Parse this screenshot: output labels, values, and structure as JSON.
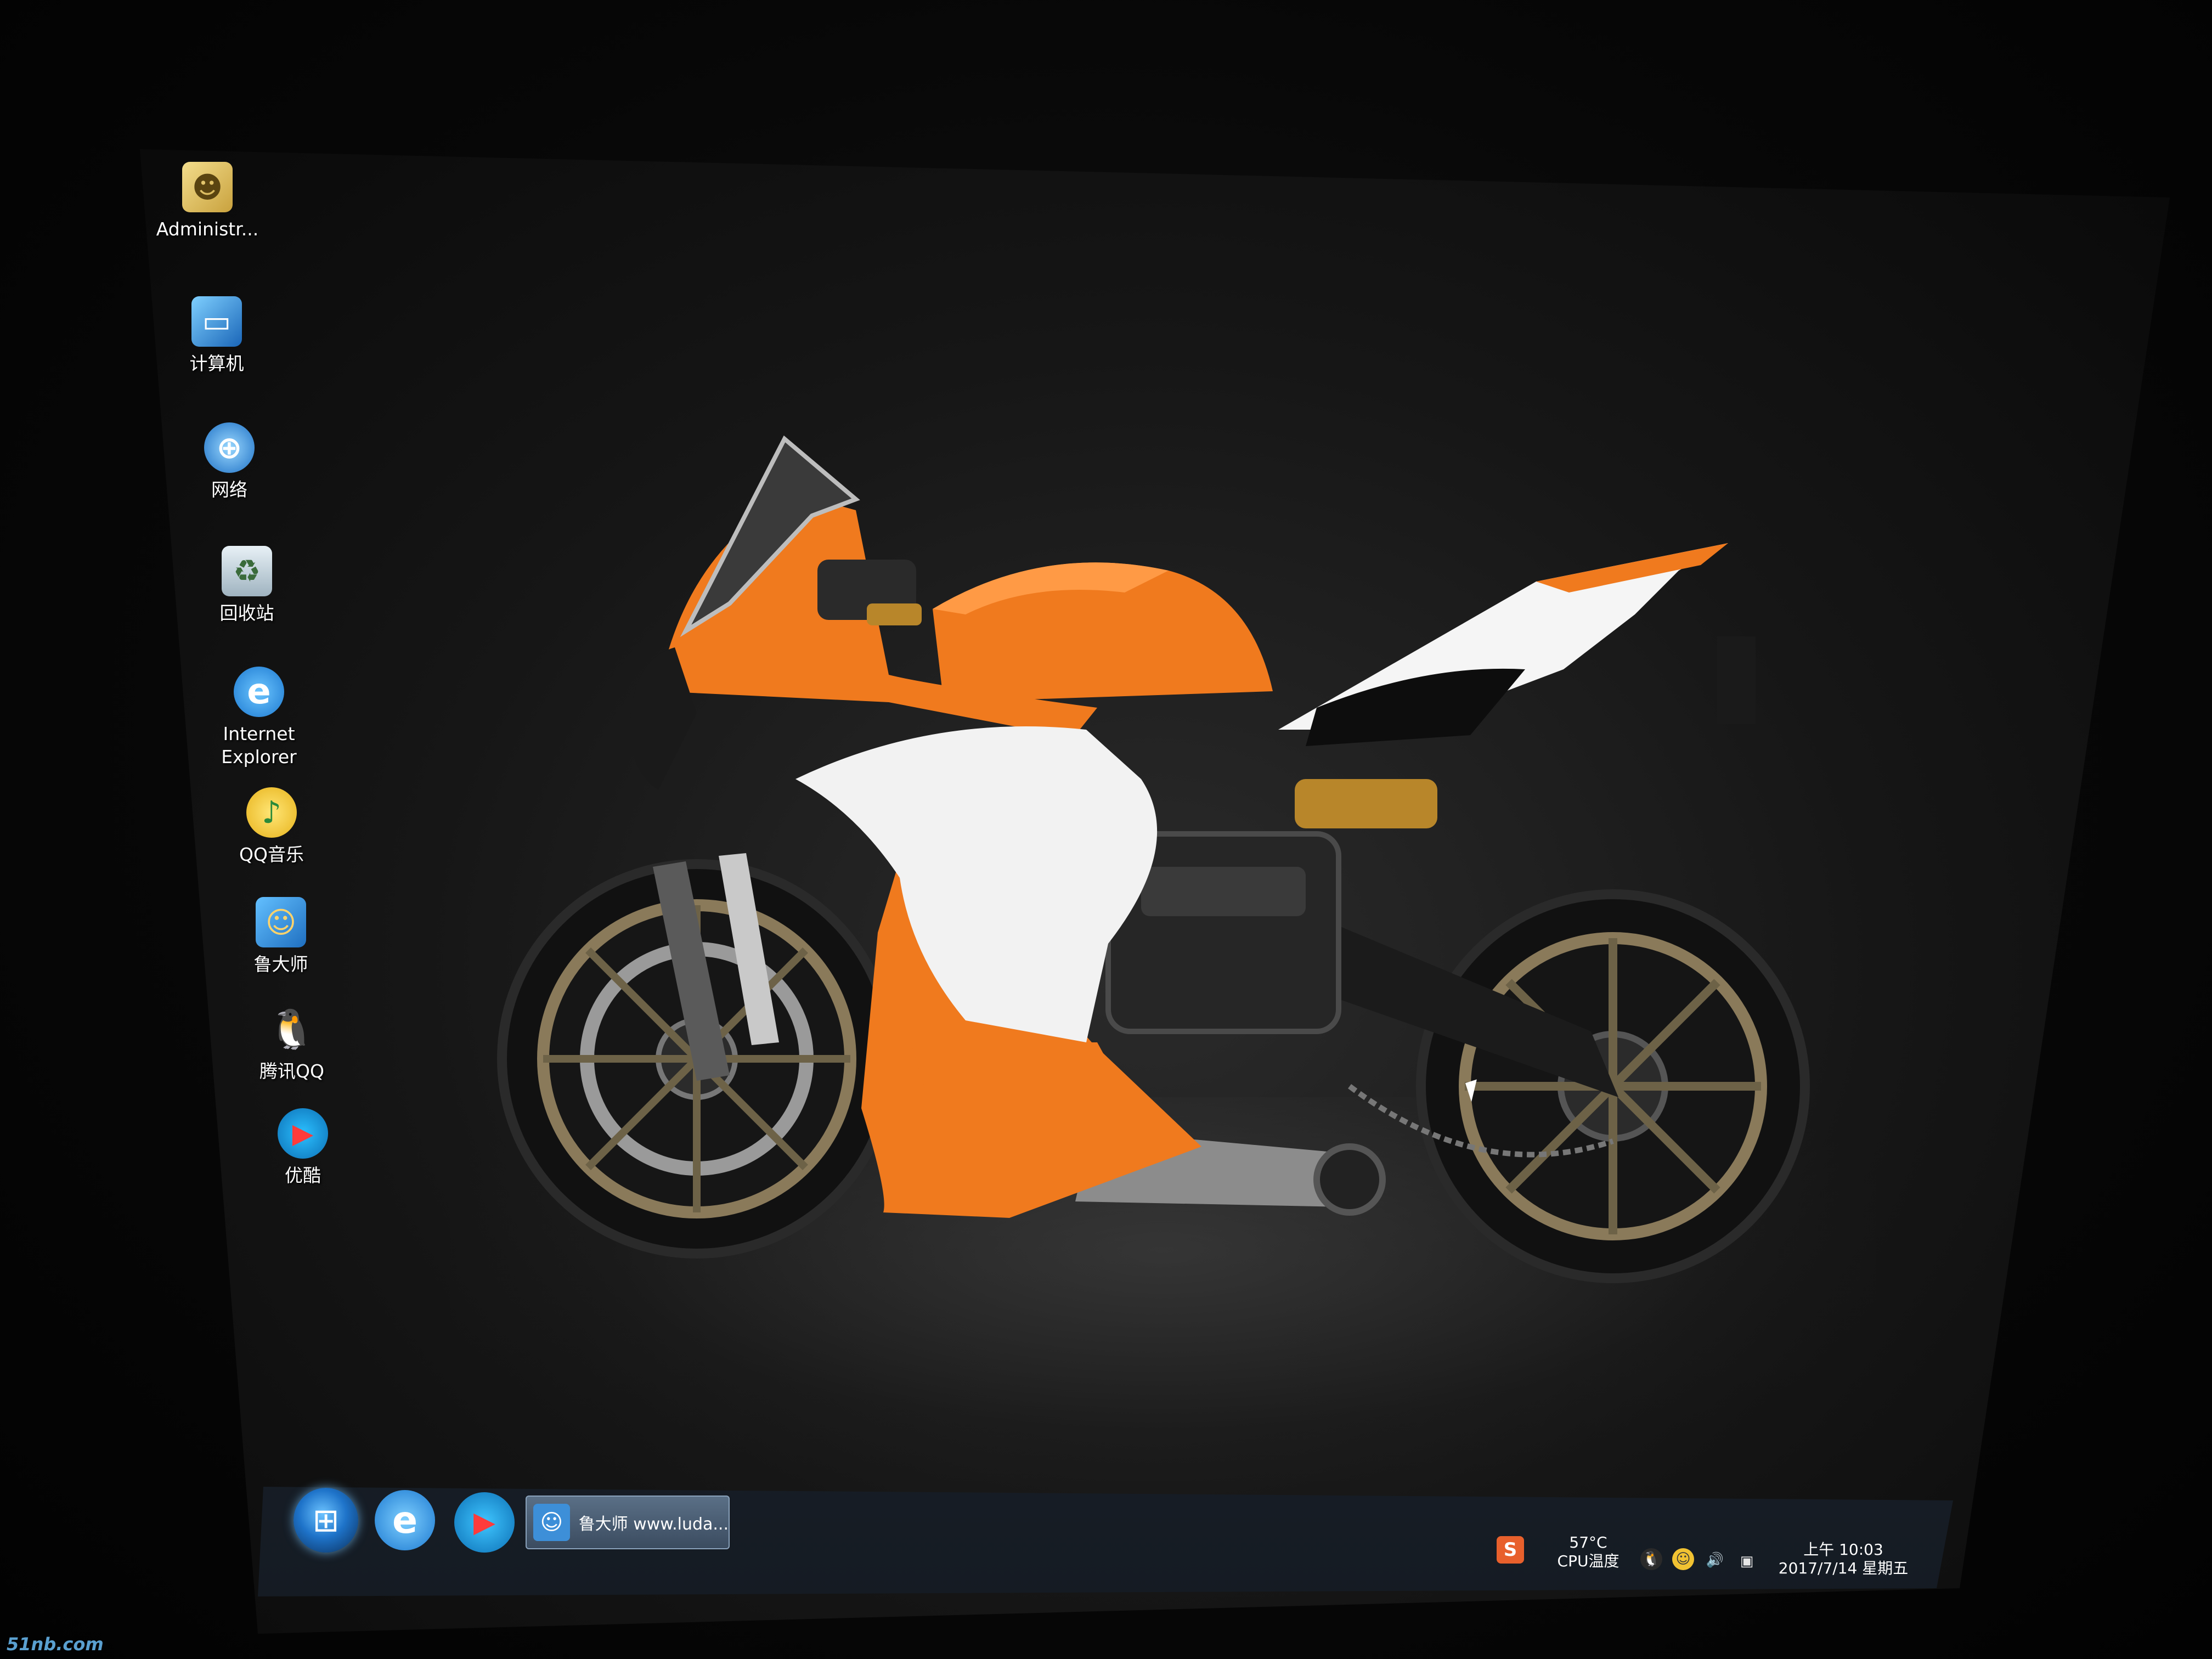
{
  "desktop": {
    "icons": [
      {
        "label": "Administr...",
        "icon": "user-folder-icon"
      },
      {
        "label": "计算机",
        "icon": "computer-icon"
      },
      {
        "label": "网络",
        "icon": "network-icon"
      },
      {
        "label": "回收站",
        "icon": "recycle-bin-icon"
      },
      {
        "label": "Internet\nExplorer",
        "icon": "internet-explorer-icon"
      },
      {
        "label": "QQ音乐",
        "icon": "qq-music-icon"
      },
      {
        "label": "鲁大师",
        "icon": "ludashi-icon"
      },
      {
        "label": "腾讯QQ",
        "icon": "tencent-qq-icon"
      },
      {
        "label": "优酷",
        "icon": "youku-icon"
      }
    ],
    "wallpaper": {
      "subject": "motorcycle-wallpaper",
      "accent": "#f07a1e",
      "body_white": "#f2f2f2"
    }
  },
  "taskbar": {
    "start_glyph": "⊞",
    "pinned": [
      {
        "glyph": "e",
        "icon": "internet-explorer-icon",
        "color": "#2f9be8"
      },
      {
        "glyph": "▶",
        "icon": "youku-icon",
        "color": "#1fa3e0"
      }
    ],
    "active_window": {
      "title": "鲁大师 www.luda...",
      "icon": "ludashi-icon"
    },
    "tray": {
      "sogou_glyph": "S",
      "cpu_temp": "57°C",
      "cpu_label": "CPU温度",
      "time": "上午 10:03",
      "date": "2017/7/14 星期五"
    }
  },
  "watermark": "51nb.com"
}
